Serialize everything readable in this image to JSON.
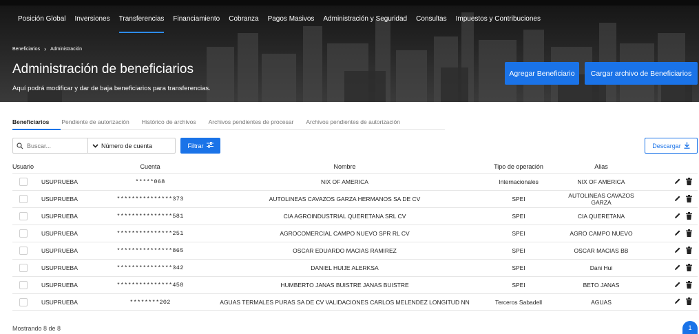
{
  "nav": {
    "items": [
      {
        "label": "Posición Global",
        "active": false
      },
      {
        "label": "Inversiones",
        "active": false
      },
      {
        "label": "Transferencias",
        "active": true
      },
      {
        "label": "Financiamiento",
        "active": false
      },
      {
        "label": "Cobranza",
        "active": false
      },
      {
        "label": "Pagos Masivos",
        "active": false
      },
      {
        "label": "Administración y Seguridad",
        "active": false
      },
      {
        "label": "Consultas",
        "active": false
      },
      {
        "label": "Impuestos y Contribuciones",
        "active": false
      }
    ]
  },
  "breadcrumb": {
    "items": [
      "Beneficiarios",
      "Administración"
    ]
  },
  "header": {
    "title": "Administración de beneficiarios",
    "subtitle": "Aquí podrá modificar y dar de baja beneficiarios para transferencias.",
    "add_button": "Agregar Beneficiario",
    "upload_button": "Cargar archivo de Beneficiarios"
  },
  "tabs": [
    {
      "label": "Beneficiarios",
      "active": true
    },
    {
      "label": "Pendiente de autorización",
      "active": false
    },
    {
      "label": "Histórico de archivos",
      "active": false
    },
    {
      "label": "Archivos pendientes de procesar",
      "active": false
    },
    {
      "label": "Archivos pendientes de autorización",
      "active": false
    }
  ],
  "toolbar": {
    "search_placeholder": "Buscar...",
    "search_field": "Número de cuenta",
    "filter_label": "Filtrar",
    "download_label": "Descargar"
  },
  "table": {
    "headers": {
      "user": "Usuario",
      "account": "Cuenta",
      "name": "Nombre",
      "operation": "Tipo de operación",
      "alias": "Alias"
    },
    "rows": [
      {
        "user": "USUPRUEBA",
        "account": "*****068",
        "name": "NIX OF AMERICA",
        "operation": "Internacionales",
        "alias": "NIX OF AMERICA"
      },
      {
        "user": "USUPRUEBA",
        "account": "***************373",
        "name": "AUTOLINEAS CAVAZOS GARZA HERMANOS SA DE CV",
        "operation": "SPEI",
        "alias": "AUTOLINEAS CAVAZOS GARZA"
      },
      {
        "user": "USUPRUEBA",
        "account": "***************581",
        "name": "CIA AGROINDUSTRIAL QUERETANA SRL CV",
        "operation": "SPEI",
        "alias": "CIA QUERETANA"
      },
      {
        "user": "USUPRUEBA",
        "account": "***************251",
        "name": "AGROCOMERCIAL CAMPO NUEVO SPR RL CV",
        "operation": "SPEI",
        "alias": "AGRO CAMPO NUEVO"
      },
      {
        "user": "USUPRUEBA",
        "account": "***************865",
        "name": "OSCAR EDUARDO MACIAS RAMIREZ",
        "operation": "SPEI",
        "alias": "OSCAR MACIAS BB"
      },
      {
        "user": "USUPRUEBA",
        "account": "***************342",
        "name": "DANIEL HUIJE ALERKSA",
        "operation": "SPEI",
        "alias": "Dani Hui"
      },
      {
        "user": "USUPRUEBA",
        "account": "***************458",
        "name": "HUMBERTO JANAS BUISTRE JANAS BUISTRE",
        "operation": "SPEI",
        "alias": "BETO JANAS"
      },
      {
        "user": "USUPRUEBA",
        "account": "********202",
        "name": "AGUAS TERMALES PURAS SA DE CV VALIDACIONES CARLOS MELENDEZ LONGITUD NN",
        "operation": "Terceros Sabadell",
        "alias": "AGUAS"
      }
    ]
  },
  "footer": {
    "showing": "Mostrando 8 de 8",
    "page": "1"
  },
  "colors": {
    "accent": "#1a73e8",
    "hero": "#1e1e1e"
  }
}
